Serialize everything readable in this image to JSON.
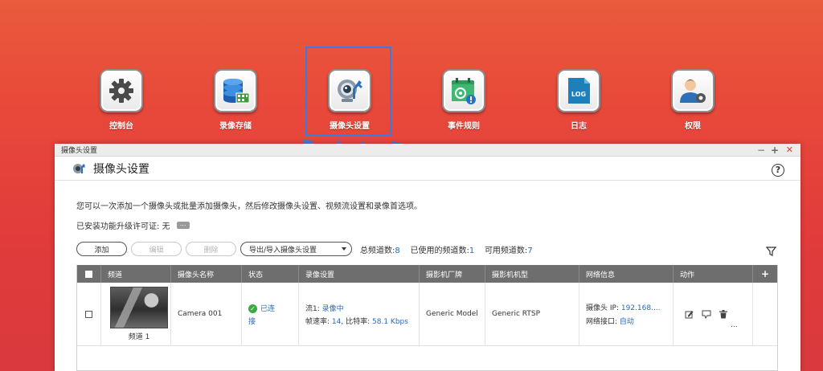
{
  "desktop": {
    "apps": [
      {
        "label": "控制台",
        "icon": "gear-icon"
      },
      {
        "label": "录像存储",
        "icon": "storage-icon"
      },
      {
        "label": "摄像头设置",
        "icon": "camera-settings-icon"
      },
      {
        "label": "事件规则",
        "icon": "calendar-event-icon"
      },
      {
        "label": "日志",
        "icon": "log-icon"
      },
      {
        "label": "权限",
        "icon": "user-permission-icon"
      }
    ],
    "log_icon_text": "LOG"
  },
  "window": {
    "titlebar": "摄像头设置",
    "title": "摄像头设置",
    "controls": {
      "minimize": "−",
      "maximize": "+",
      "close": "✕"
    },
    "help": "?",
    "description": "您可以一次添加一个摄像头或批量添加摄像头，然后修改摄像头设置、视频流设置和录像首选项。",
    "license_text": "已安装功能升级许可证: 无",
    "license_more": "..."
  },
  "toolbar": {
    "add": "添加",
    "edit": "编辑",
    "delete": "删除",
    "import_export": "导出/导入摄像头设置",
    "total_label": "总频道数:",
    "total_value": "8",
    "used_label": "已使用的频道数:",
    "used_value": "1",
    "available_label": "可用频道数:",
    "available_value": "7"
  },
  "table": {
    "headers": [
      "频道",
      "摄像头名称",
      "状态",
      "录像设置",
      "摄影机厂牌",
      "摄影机机型",
      "网络信息",
      "动作",
      "+"
    ],
    "rows": [
      {
        "channel": "频道 1",
        "camera_name": "Camera 001",
        "status_line1": "已连",
        "status_line2": "接",
        "stream_label": "流1:",
        "stream_value": "录像中",
        "fps_label": "帧速率:",
        "fps_value": "14",
        "bitrate_label": ", 比特率:",
        "bitrate_value": "58.1 Kbps",
        "brand": "Generic Model",
        "model": "Generic RTSP",
        "ip_label": "摄像头 IP:",
        "ip_value": "192.168....",
        "port_label": "网络接口:",
        "port_value": "自动",
        "more": "..."
      }
    ]
  },
  "colors": {
    "accent_blue": "#2a6ab5",
    "header_gray": "#6e6e6e",
    "highlight_blue": "#3a7be0",
    "close_red": "#e03a3a",
    "status_green": "#39a845"
  }
}
